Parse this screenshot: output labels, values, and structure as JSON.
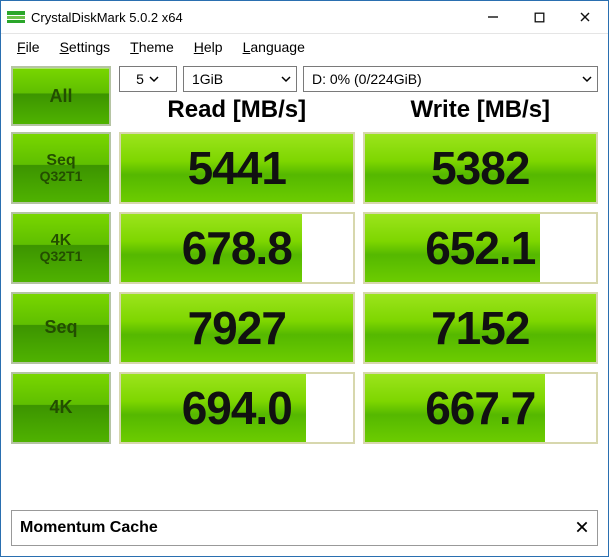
{
  "window": {
    "title": "CrystalDiskMark 5.0.2 x64"
  },
  "menu": {
    "file": {
      "u": "F",
      "rest": "ile"
    },
    "settings": {
      "u": "S",
      "rest": "ettings"
    },
    "theme": {
      "u": "T",
      "rest": "heme"
    },
    "help": {
      "u": "H",
      "rest": "elp"
    },
    "language": {
      "u": "L",
      "rest": "anguage"
    }
  },
  "controls": {
    "all_label": "All",
    "runs": "5",
    "test_size": "1GiB",
    "drive": "D: 0% (0/224GiB)"
  },
  "columns": {
    "read": "Read [MB/s]",
    "write": "Write [MB/s]"
  },
  "rows": [
    {
      "label1": "Seq",
      "label2": "Q32T1",
      "read_text": "5441",
      "read_fill": 100,
      "write_text": "5382",
      "write_fill": 100
    },
    {
      "label1": "4K",
      "label2": "Q32T1",
      "read_text": "678.8",
      "read_fill": 78,
      "write_text": "652.1",
      "write_fill": 76
    },
    {
      "label1": "Seq",
      "label2": "",
      "read_text": "7927",
      "read_fill": 100,
      "write_text": "7152",
      "write_fill": 100
    },
    {
      "label1": "4K",
      "label2": "",
      "read_text": "694.0",
      "read_fill": 80,
      "write_text": "667.7",
      "write_fill": 78
    }
  ],
  "footer": {
    "label": "Momentum Cache"
  },
  "chart_data": {
    "type": "table",
    "unit": "MB/s",
    "tests": [
      "Seq Q32T1",
      "4K Q32T1",
      "Seq",
      "4K"
    ],
    "read": [
      5441,
      678.8,
      7927,
      694.0
    ],
    "write": [
      5382,
      652.1,
      7152,
      667.7
    ],
    "runs": 5,
    "test_size_GiB": 1,
    "drive": {
      "letter": "D",
      "used_pct": 0,
      "used_GiB": 0,
      "total_GiB": 224
    }
  }
}
